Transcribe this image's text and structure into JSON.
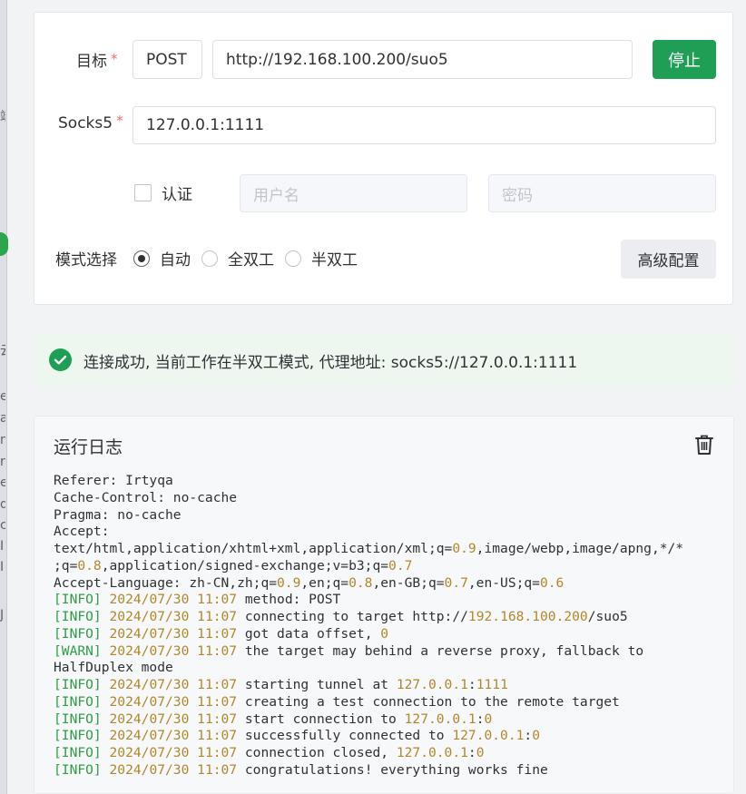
{
  "form": {
    "target_label": "目标",
    "required_mark": "*",
    "method": "POST",
    "url": "http://192.168.100.200/suo5",
    "stop_button": "停止",
    "socks5_label": "Socks5",
    "socks5_value": "127.0.0.1:1111",
    "auth_label": "认证",
    "username_placeholder": "用户名",
    "password_placeholder": "密码",
    "mode_label": "模式选择",
    "mode_options": [
      "自动",
      "全双工",
      "半双工"
    ],
    "mode_selected": "自动",
    "advanced_button": "高级配置"
  },
  "alert": {
    "text": "连接成功, 当前工作在半双工模式, 代理地址: socks5://127.0.0.1:1111",
    "status_color": "#1f9f55"
  },
  "log": {
    "title": "运行日志",
    "clear_icon": "trash-icon",
    "lines": [
      [
        {
          "t": "Referer: Irtyqa"
        }
      ],
      [
        {
          "t": "Cache-Control: no-cache"
        }
      ],
      [
        {
          "t": "Pragma: no-cache"
        }
      ],
      [
        {
          "t": "Accept:"
        }
      ],
      [
        {
          "t": "text/html,application/xhtml+xml,application/xml;q="
        },
        {
          "t": "0.9",
          "c": "num"
        },
        {
          "t": ",image/webp,image/apng,*/*"
        }
      ],
      [
        {
          "t": ";q="
        },
        {
          "t": "0.8",
          "c": "num"
        },
        {
          "t": ",application/signed-exchange;v=b3;q="
        },
        {
          "t": "0.7",
          "c": "num"
        }
      ],
      [
        {
          "t": "Accept-Language: zh-CN,zh;q="
        },
        {
          "t": "0.9",
          "c": "num"
        },
        {
          "t": ",en;q="
        },
        {
          "t": "0.8",
          "c": "num"
        },
        {
          "t": ",en-GB;q="
        },
        {
          "t": "0.7",
          "c": "num"
        },
        {
          "t": ",en-US;q="
        },
        {
          "t": "0.6",
          "c": "num"
        }
      ],
      [
        {
          "t": "[INFO]",
          "c": "ok"
        },
        {
          "t": " "
        },
        {
          "t": "2024/07/30 11:07",
          "c": "num"
        },
        {
          "t": " method: POST"
        }
      ],
      [
        {
          "t": "[INFO]",
          "c": "ok"
        },
        {
          "t": " "
        },
        {
          "t": "2024/07/30 11:07",
          "c": "num"
        },
        {
          "t": " connecting to target http://"
        },
        {
          "t": "192.168.100.200",
          "c": "num"
        },
        {
          "t": "/suo5"
        }
      ],
      [
        {
          "t": "[INFO]",
          "c": "ok"
        },
        {
          "t": " "
        },
        {
          "t": "2024/07/30 11:07",
          "c": "num"
        },
        {
          "t": " got data offset, "
        },
        {
          "t": "0",
          "c": "num"
        }
      ],
      [
        {
          "t": "[WARN]",
          "c": "warn"
        },
        {
          "t": " "
        },
        {
          "t": "2024/07/30 11:07",
          "c": "num"
        },
        {
          "t": " the target may behind a reverse proxy, fallback to"
        }
      ],
      [
        {
          "t": "HalfDuplex mode"
        }
      ],
      [
        {
          "t": "[INFO]",
          "c": "ok"
        },
        {
          "t": " "
        },
        {
          "t": "2024/07/30 11:07",
          "c": "num"
        },
        {
          "t": " starting tunnel at "
        },
        {
          "t": "127.0.0.1",
          "c": "num"
        },
        {
          "t": ":"
        },
        {
          "t": "1111",
          "c": "num"
        }
      ],
      [
        {
          "t": "[INFO]",
          "c": "ok"
        },
        {
          "t": " "
        },
        {
          "t": "2024/07/30 11:07",
          "c": "num"
        },
        {
          "t": " creating a test connection to the remote target"
        }
      ],
      [
        {
          "t": "[INFO]",
          "c": "ok"
        },
        {
          "t": " "
        },
        {
          "t": "2024/07/30 11:07",
          "c": "num"
        },
        {
          "t": " start connection to "
        },
        {
          "t": "127.0.0.1",
          "c": "num"
        },
        {
          "t": ":"
        },
        {
          "t": "0",
          "c": "num"
        }
      ],
      [
        {
          "t": "[INFO]",
          "c": "ok"
        },
        {
          "t": " "
        },
        {
          "t": "2024/07/30 11:07",
          "c": "num"
        },
        {
          "t": " successfully connected to "
        },
        {
          "t": "127.0.0.1",
          "c": "num"
        },
        {
          "t": ":"
        },
        {
          "t": "0",
          "c": "num"
        }
      ],
      [
        {
          "t": "[INFO]",
          "c": "ok"
        },
        {
          "t": " "
        },
        {
          "t": "2024/07/30 11:07",
          "c": "num"
        },
        {
          "t": " connection closed, "
        },
        {
          "t": "127.0.0.1",
          "c": "num"
        },
        {
          "t": ":"
        },
        {
          "t": "0",
          "c": "num"
        }
      ],
      [
        {
          "t": "[INFO]",
          "c": "ok"
        },
        {
          "t": " "
        },
        {
          "t": "2024/07/30 11:07",
          "c": "num"
        },
        {
          "t": " congratulations! everything works fine"
        }
      ]
    ]
  },
  "background_edge": {
    "glyphs": [
      "端",
      "云",
      "e",
      "a",
      "n",
      "r",
      "e",
      "q",
      "c",
      "I",
      "I",
      "J"
    ]
  }
}
